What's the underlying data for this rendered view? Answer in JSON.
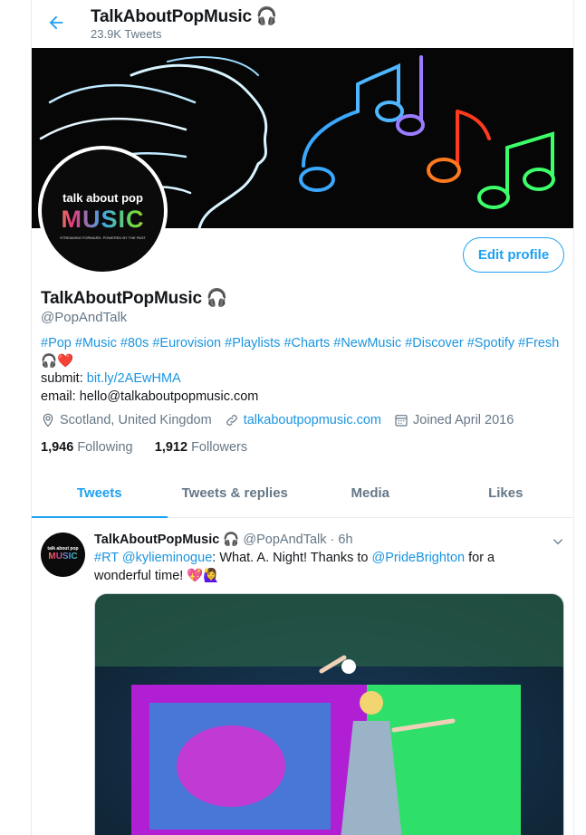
{
  "header": {
    "title": "TalkAboutPopMusic 🎧",
    "tweet_count": "23.9K Tweets"
  },
  "profile": {
    "avatar_line1": "talk about pop",
    "avatar_line2": "MUSIC",
    "avatar_line3": "STREAMING FORWARD. POWERED BY THE PAST",
    "edit_label": "Edit profile",
    "name": "TalkAboutPopMusic 🎧",
    "handle": "@PopAndTalk",
    "hashtags": [
      "#Pop",
      "#Music",
      "#80s",
      "#Eurovision",
      "#Playlists",
      "#Charts",
      "#NewMusic",
      "#Discover",
      "#Spotify",
      "#Fresh"
    ],
    "bio_emoji": "🎧❤️",
    "submit_label": "submit: ",
    "submit_link": "bit.ly/2AEwHMA",
    "email_line": "email: hello@talkaboutpopmusic.com",
    "location": "Scotland, United Kingdom",
    "website": "talkaboutpopmusic.com",
    "joined": "Joined April 2016",
    "following_count": "1,946",
    "following_label": "Following",
    "followers_count": "1,912",
    "followers_label": "Followers"
  },
  "tabs": [
    {
      "label": "Tweets",
      "active": true
    },
    {
      "label": "Tweets & replies",
      "active": false
    },
    {
      "label": "Media",
      "active": false
    },
    {
      "label": "Likes",
      "active": false
    }
  ],
  "tweet": {
    "name": "TalkAboutPopMusic 🎧",
    "handle": "@PopAndTalk",
    "time": "· 6h",
    "rt": "#RT",
    "mention1": "@kylieminogue",
    "text1": ": What. A. Night! Thanks to ",
    "mention2": "@PrideBrighton",
    "text2": " for a wonderful time!",
    "emoji": "💖🙋‍♀️"
  },
  "colors": {
    "accent": "#1da1f2",
    "link": "#1b95e0",
    "secondary_text": "#657786",
    "border": "#e6ecf0"
  },
  "icons": [
    "back-arrow-icon",
    "location-pin-icon",
    "link-icon",
    "calendar-icon",
    "chevron-down-icon"
  ]
}
